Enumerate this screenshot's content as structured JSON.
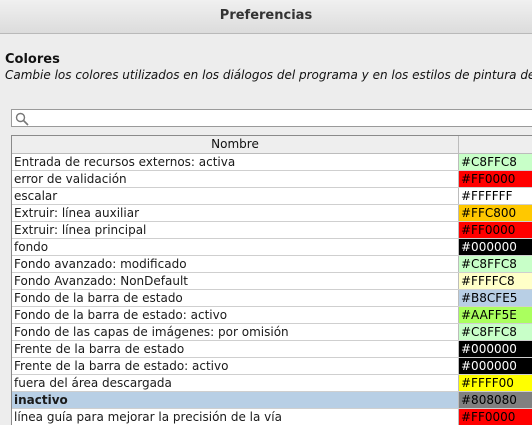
{
  "window": {
    "title": "Preferencias"
  },
  "section": {
    "title": "Colores",
    "description": "Cambie los colores utilizados en los diálogos del programa y en los estilos de pintura de m"
  },
  "search": {
    "value": ""
  },
  "table": {
    "header": "Nombre",
    "rows": [
      {
        "name": "Entrada de recursos externos: activa",
        "value": "#C8FFC8",
        "color": "#C8FFC8",
        "text_color": "#000000"
      },
      {
        "name": "error de validación",
        "value": "#FF0000",
        "color": "#FF0000",
        "text_color": "#000000"
      },
      {
        "name": "escalar",
        "value": "#FFFFFF",
        "color": "#FFFFFF",
        "text_color": "#000000"
      },
      {
        "name": "Extruir: línea auxiliar",
        "value": "#FFC800",
        "color": "#FFC800",
        "text_color": "#000000"
      },
      {
        "name": "Extruir: línea principal",
        "value": "#FF0000",
        "color": "#FF0000",
        "text_color": "#000000"
      },
      {
        "name": "fondo",
        "value": "#000000",
        "color": "#000000",
        "text_color": "#FFFFFF"
      },
      {
        "name": "Fondo avanzado: modificado",
        "value": "#C8FFC8",
        "color": "#C8FFC8",
        "text_color": "#000000"
      },
      {
        "name": "Fondo Avanzado: NonDefault",
        "value": "#FFFFC8",
        "color": "#FFFFC8",
        "text_color": "#000000"
      },
      {
        "name": "Fondo de la barra de estado",
        "value": "#B8CFE5",
        "color": "#B8CFE5",
        "text_color": "#000000"
      },
      {
        "name": "Fondo de la barra de estado: activo",
        "value": "#AAFF5E",
        "color": "#AAFF5E",
        "text_color": "#000000"
      },
      {
        "name": "Fondo de las capas de imágenes: por omisión",
        "value": "#C8FFC8",
        "color": "#C8FFC8",
        "text_color": "#000000"
      },
      {
        "name": "Frente de la barra de estado",
        "value": "#000000",
        "color": "#000000",
        "text_color": "#FFFFFF"
      },
      {
        "name": "Frente de la barra de estado: activo",
        "value": "#000000",
        "color": "#000000",
        "text_color": "#FFFFFF"
      },
      {
        "name": "fuera del área descargada",
        "value": "#FFFF00",
        "color": "#FFFF00",
        "text_color": "#000000"
      },
      {
        "name": "inactivo",
        "value": "#808080",
        "color": "#808080",
        "text_color": "#000000",
        "selected": true
      },
      {
        "name": "línea guía para mejorar la precisión de la vía",
        "value": "#FF0000",
        "color": "#FF0000",
        "text_color": "#000000"
      },
      {
        "name": "",
        "value": "",
        "color": "#FFFFFF",
        "text_color": "#000000"
      }
    ]
  }
}
